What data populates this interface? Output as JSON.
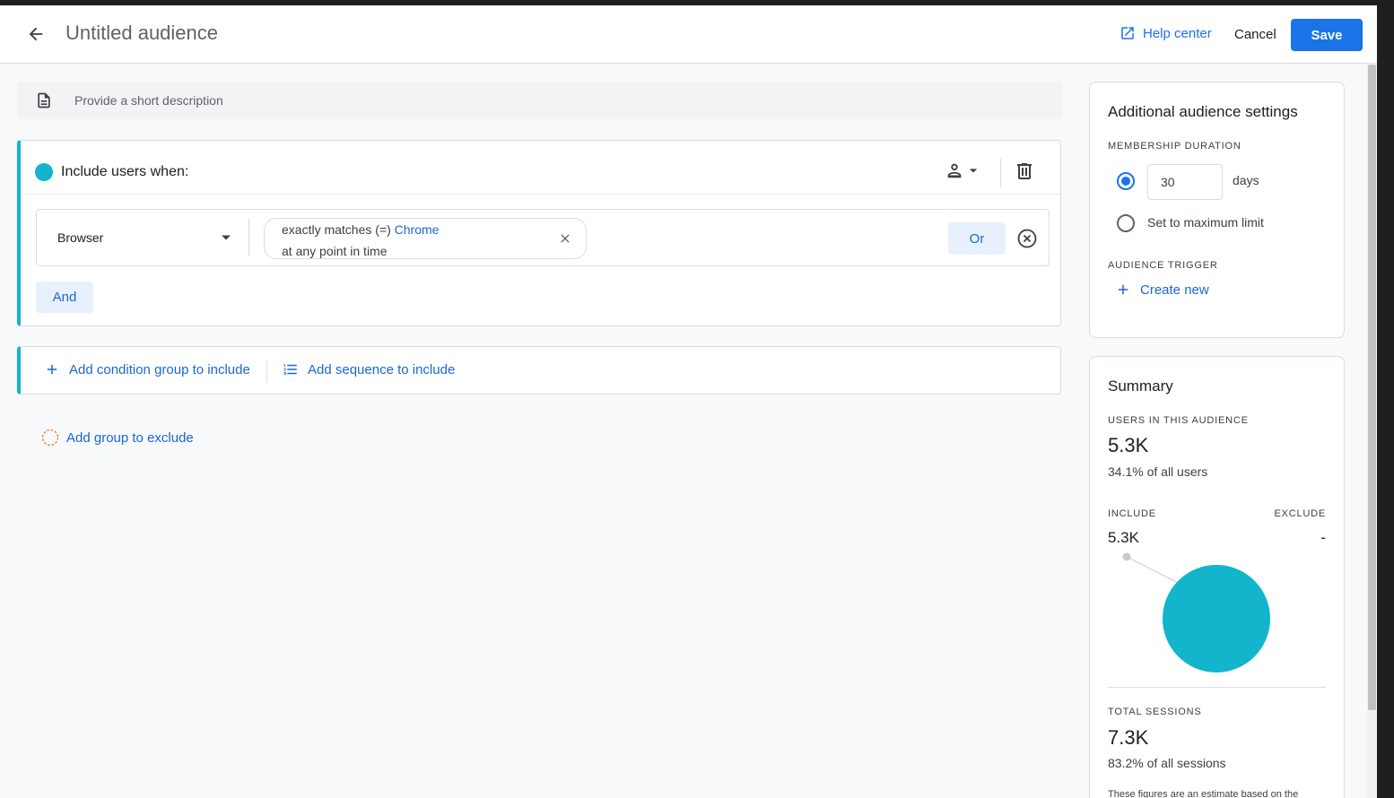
{
  "header": {
    "title": "Untitled audience",
    "help_label": "Help center",
    "cancel_label": "Cancel",
    "save_label": "Save"
  },
  "description": {
    "placeholder": "Provide a short description"
  },
  "include_group": {
    "title": "Include users when:",
    "condition": {
      "dimension": "Browser",
      "operator_text": "exactly matches (=)",
      "value": "Chrome",
      "scope_text": "at any point in time"
    },
    "or_label": "Or",
    "and_label": "And"
  },
  "add_bar": {
    "add_condition_label": "Add condition group to include",
    "add_sequence_label": "Add sequence to include"
  },
  "exclude": {
    "label": "Add group to exclude"
  },
  "settings": {
    "title": "Additional audience settings",
    "membership_label": "MEMBERSHIP DURATION",
    "duration_value": "30",
    "days_label": "days",
    "max_limit_label": "Set to maximum limit",
    "trigger_label": "AUDIENCE TRIGGER",
    "create_new_label": "Create new"
  },
  "summary": {
    "title": "Summary",
    "users_label": "USERS IN THIS AUDIENCE",
    "users_value": "5.3K",
    "users_pct": "34.1% of all users",
    "include_label": "INCLUDE",
    "exclude_label": "EXCLUDE",
    "include_value": "5.3K",
    "exclude_value": "-",
    "sessions_label": "TOTAL SESSIONS",
    "sessions_value": "7.3K",
    "sessions_pct": "83.2% of all sessions",
    "footnote": "These figures are an estimate based on the"
  },
  "colors": {
    "accent": "#1a73e8",
    "teal": "#12b5cb",
    "link": "#1967d2"
  }
}
